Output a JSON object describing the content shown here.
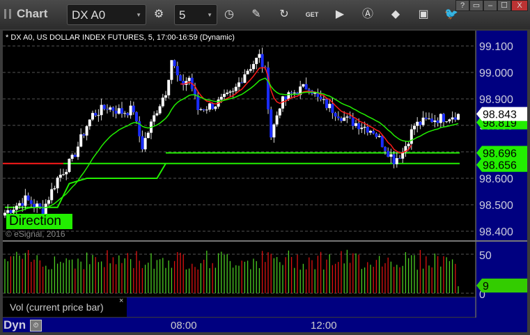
{
  "titlebar": {
    "title": "Chart",
    "symbol": "DX A0",
    "interval": "5",
    "window_buttons": [
      "?",
      "▭",
      "–",
      "☐",
      "X"
    ]
  },
  "legend": "* DX A0, US DOLLAR INDEX FUTURES, 5, 17:00-16:59 (Dynamic)",
  "direction_label": "Direction",
  "copyright": "© eSignal, 2016",
  "volume_pane": {
    "label": "Vol (current price bar)",
    "close": "×",
    "ticks": [
      "50",
      "0"
    ],
    "current": "9"
  },
  "bottom": {
    "mode": "Dyn",
    "time_labels": [
      "08:00",
      "12:00"
    ]
  },
  "colors": {
    "up": "#ffffff",
    "down": "#1a2cff",
    "fast_ma": "#ff1a1a",
    "slow_ma": "#22ee00",
    "axis_bg": "#000080"
  },
  "chart_data": {
    "type": "candlestick",
    "ylim": [
      98.37,
      99.15
    ],
    "yticks": [
      "99.100",
      "99.000",
      "98.900",
      "98.800",
      "98.700",
      "98.600",
      "98.500",
      "98.400"
    ],
    "price_labels": [
      {
        "text": "98.843",
        "value": 98.843,
        "color": "#ffffff"
      },
      {
        "text": "98.819",
        "value": 98.819,
        "color": "#22ee00"
      },
      {
        "text": "98.696",
        "value": 98.696,
        "color": "#22ee00"
      },
      {
        "text": "98.656",
        "value": 98.656,
        "color": "#22ee00"
      }
    ],
    "bars": 156,
    "close_keypoints": [
      [
        0,
        98.47
      ],
      [
        7,
        98.52
      ],
      [
        13,
        98.48
      ],
      [
        18,
        98.6
      ],
      [
        23,
        98.67
      ],
      [
        28,
        98.8
      ],
      [
        30,
        98.84
      ],
      [
        35,
        98.87
      ],
      [
        40,
        98.85
      ],
      [
        44,
        98.86
      ],
      [
        45,
        98.8
      ],
      [
        47,
        98.72
      ],
      [
        52,
        98.86
      ],
      [
        55,
        98.93
      ],
      [
        57,
        99.05
      ],
      [
        60,
        98.95
      ],
      [
        63,
        98.98
      ],
      [
        66,
        98.86
      ],
      [
        72,
        98.88
      ],
      [
        78,
        98.92
      ],
      [
        82,
        99.0
      ],
      [
        87,
        99.06
      ],
      [
        89,
        99.0
      ],
      [
        91,
        98.76
      ],
      [
        94,
        98.88
      ],
      [
        98,
        98.92
      ],
      [
        104,
        98.95
      ],
      [
        107,
        98.9
      ],
      [
        112,
        98.86
      ],
      [
        117,
        98.82
      ],
      [
        122,
        98.8
      ],
      [
        126,
        98.78
      ],
      [
        133,
        98.67
      ],
      [
        136,
        98.7
      ],
      [
        140,
        98.8
      ],
      [
        145,
        98.82
      ],
      [
        150,
        98.83
      ],
      [
        155,
        98.843
      ]
    ],
    "levels": [
      {
        "value": 98.656,
        "color": "#ff1a1a",
        "from": 0,
        "to": 20
      },
      {
        "value": 98.656,
        "color": "#22ee00",
        "from": 20,
        "to": 155
      },
      {
        "value": 98.696,
        "color": "#22ee00",
        "from": 55,
        "to": 155
      }
    ],
    "stair_line": [
      [
        0,
        98.49
      ],
      [
        18,
        98.49
      ],
      [
        22,
        98.58
      ],
      [
        28,
        98.6
      ],
      [
        52,
        98.6
      ],
      [
        55,
        98.656
      ]
    ]
  }
}
